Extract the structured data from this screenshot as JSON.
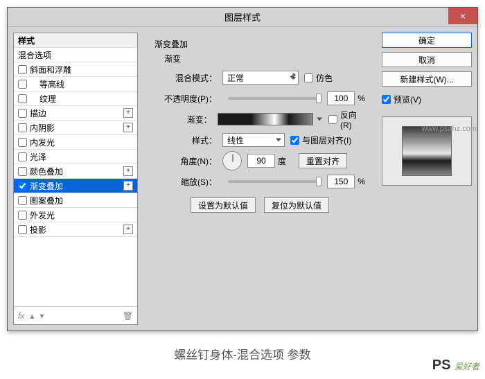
{
  "dialog": {
    "title": "图层样式",
    "close_icon": "×"
  },
  "styles": {
    "header": "样式",
    "blend_options": "混合选项",
    "items": [
      {
        "label": "斜面和浮雕",
        "checked": false,
        "plus": false,
        "indent": 0
      },
      {
        "label": "等高线",
        "checked": false,
        "plus": false,
        "indent": 1
      },
      {
        "label": "纹理",
        "checked": false,
        "plus": false,
        "indent": 1
      },
      {
        "label": "描边",
        "checked": false,
        "plus": true,
        "indent": 0
      },
      {
        "label": "内阴影",
        "checked": false,
        "plus": true,
        "indent": 0
      },
      {
        "label": "内发光",
        "checked": false,
        "plus": false,
        "indent": 0
      },
      {
        "label": "光泽",
        "checked": false,
        "plus": false,
        "indent": 0
      },
      {
        "label": "颜色叠加",
        "checked": false,
        "plus": true,
        "indent": 0
      },
      {
        "label": "渐变叠加",
        "checked": true,
        "plus": true,
        "indent": 0,
        "selected": true
      },
      {
        "label": "图案叠加",
        "checked": false,
        "plus": false,
        "indent": 0
      },
      {
        "label": "外发光",
        "checked": false,
        "plus": false,
        "indent": 0
      },
      {
        "label": "投影",
        "checked": false,
        "plus": true,
        "indent": 0
      }
    ],
    "footer_fx": "fx"
  },
  "grad": {
    "section": "渐变叠加",
    "sub": "渐变",
    "blend_mode_label": "混合模式：",
    "blend_mode_value": "正常",
    "dither_label": "仿色",
    "opacity_label": "不透明度(P)：",
    "opacity_value": "100",
    "percent": "%",
    "gradient_label": "渐变：",
    "reverse_label": "反向(R)",
    "style_label": "样式：",
    "style_value": "线性",
    "align_label": "与图层对齐(I)",
    "angle_label": "角度(N)：",
    "angle_value": "90",
    "degree": "度",
    "reset_align": "重置对齐",
    "scale_label": "缩放(S)：",
    "scale_value": "150",
    "set_default": "设置为默认值",
    "reset_default": "复位为默认值"
  },
  "buttons": {
    "ok": "确定",
    "cancel": "取消",
    "new_style": "新建样式(W)...",
    "preview": "预览(V)"
  },
  "caption": "螺丝钉身体-混合选项 参数",
  "watermarks": {
    "url": "www.psahz.com",
    "logo_ps": "PS",
    "logo_text": "爱好者"
  }
}
